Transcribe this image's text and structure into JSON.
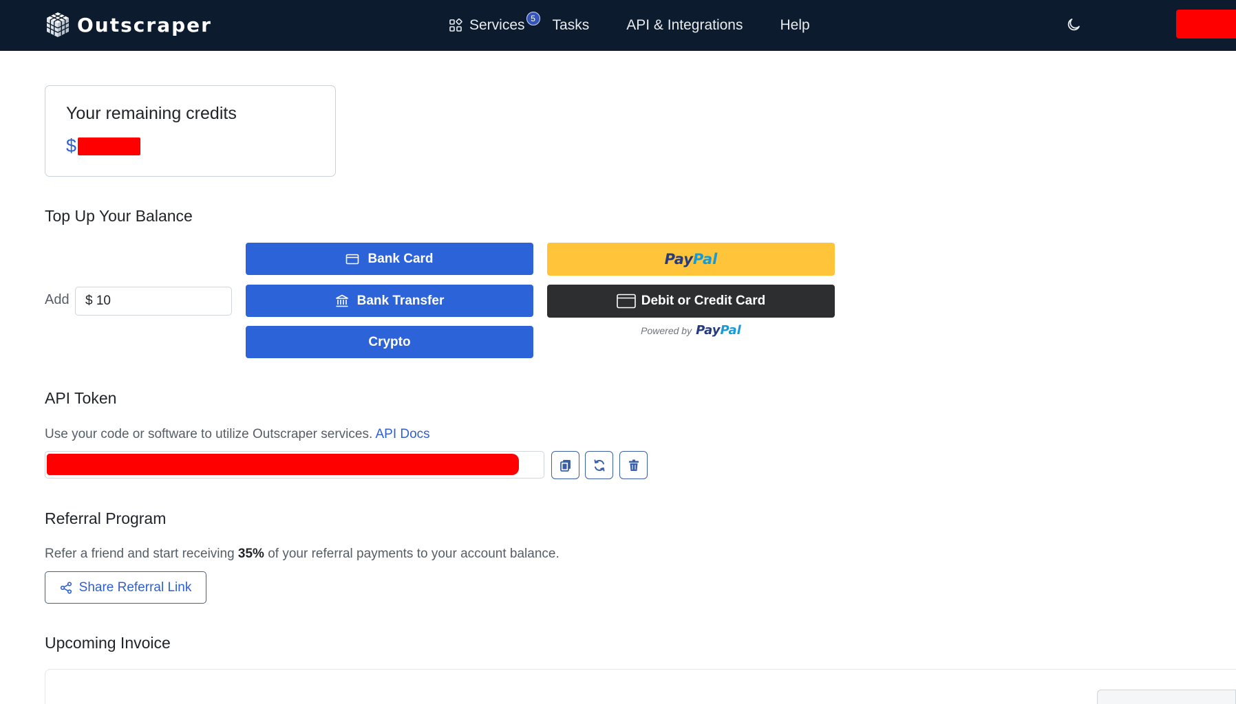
{
  "header": {
    "brand": "Outscraper",
    "nav": {
      "services": "Services",
      "services_badge": "5",
      "tasks": "Tasks",
      "api_integrations": "API & Integrations",
      "help": "Help"
    },
    "icons": [
      "grid-icon",
      "moon-icon"
    ]
  },
  "credits": {
    "title": "Your remaining credits",
    "currency": "$"
  },
  "topup": {
    "title": "Top Up Your Balance",
    "add_label": "Add",
    "amount_value": "$ 10",
    "bank_card": "Bank Card",
    "bank_transfer": "Bank Transfer",
    "crypto": "Crypto",
    "paypal_a": "Pay",
    "paypal_b": "Pal",
    "debit_credit": "Debit or Credit Card",
    "powered_by": "Powered by"
  },
  "api_token": {
    "title": "API Token",
    "description": "Use your code or software to utilize Outscraper services.",
    "docs_link": "API Docs"
  },
  "referral": {
    "title": "Referral Program",
    "desc_before": "Refer a friend and start receiving ",
    "percent": "35%",
    "desc_after": " of your referral payments to your account balance.",
    "share_button": "Share Referral Link"
  },
  "invoice": {
    "title": "Upcoming Invoice"
  },
  "colors": {
    "navbar": "#0c1b2e",
    "primary": "#2d63d8",
    "paypal_yellow": "#ffc439",
    "paypal_dark": "#2c2e2f",
    "redaction": "#ff0000"
  }
}
